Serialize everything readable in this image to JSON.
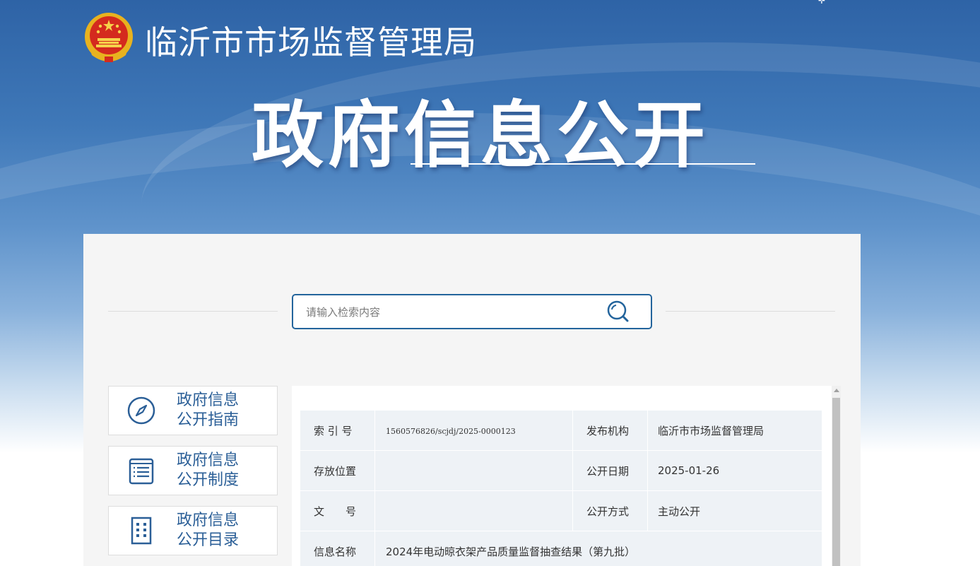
{
  "header": {
    "site_name": "临沂市市场监督管理局",
    "portal_title": "政府信息公开",
    "emblem_icon": "national-emblem-icon"
  },
  "search": {
    "placeholder": "请输入检索内容",
    "button_icon": "search-icon"
  },
  "sidebar": {
    "items": [
      {
        "label_line1": "政府信息",
        "label_line2": "公开指南",
        "icon": "compass-icon"
      },
      {
        "label_line1": "政府信息",
        "label_line2": "公开制度",
        "icon": "document-list-icon"
      },
      {
        "label_line1": "政府信息",
        "label_line2": "公开目录",
        "icon": "building-grid-icon"
      }
    ]
  },
  "document_meta": {
    "rows": [
      {
        "label1": "索 引 号",
        "value1": "1560576826/scjdj/2025-0000123",
        "label2": "发布机构",
        "value2": "临沂市市场监督管理局"
      },
      {
        "label1": "存放位置",
        "value1": "",
        "label2": "公开日期",
        "value2": "2025-01-26"
      },
      {
        "label1": "文　　号",
        "value1": "",
        "label2": "公开方式",
        "value2": "主动公开"
      }
    ],
    "name_label": "信息名称",
    "name_value": "2024年电动晾衣架产品质量监督抽查结果（第九批）"
  },
  "colors": {
    "banner_top": "#2e63a6",
    "accent_blue": "#23649c",
    "sidebar_text": "#2b5f97",
    "table_cell": "#eef2f6",
    "panel_bg": "#f5f5f5"
  }
}
